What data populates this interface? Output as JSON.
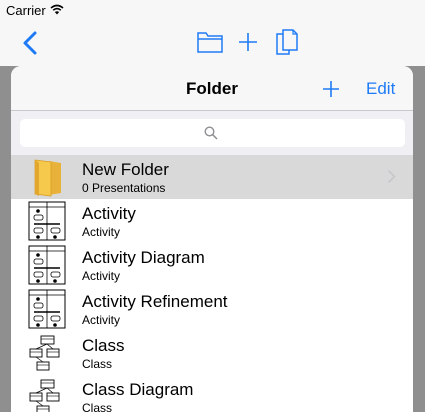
{
  "status_bar": {
    "carrier": "Carrier",
    "wifi_icon": "wifi-icon"
  },
  "toolbar": {
    "back_icon": "chevron-left-icon",
    "folder_icon": "folder-icon",
    "add_icon": "plus-icon",
    "copy_icon": "copy-icon",
    "accent": "#1e7bf5"
  },
  "popover": {
    "title": "Folder",
    "add_icon": "plus-icon",
    "edit_label": "Edit",
    "search": {
      "placeholder": "",
      "icon": "search-icon"
    }
  },
  "items": [
    {
      "title": "New Folder",
      "subtitle": "0 Presentations",
      "icon": "folder-icon",
      "selected": true
    },
    {
      "title": "Activity",
      "subtitle": "Activity",
      "icon": "activity-diagram-icon",
      "selected": false
    },
    {
      "title": "Activity Diagram",
      "subtitle": "Activity",
      "icon": "activity-diagram-icon",
      "selected": false
    },
    {
      "title": "Activity Refinement",
      "subtitle": "Activity",
      "icon": "activity-diagram-icon",
      "selected": false
    },
    {
      "title": "Class",
      "subtitle": "Class",
      "icon": "class-diagram-icon",
      "selected": false
    },
    {
      "title": "Class Diagram",
      "subtitle": "Class",
      "icon": "class-diagram-icon",
      "selected": false
    }
  ]
}
